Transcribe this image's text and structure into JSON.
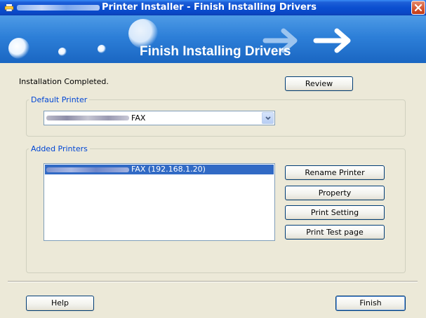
{
  "window": {
    "title": "Printer Installer - Finish Installing Drivers",
    "close_icon": "close-icon"
  },
  "banner": {
    "title": "Finish Installing Drivers"
  },
  "status": {
    "text": "Installation Completed."
  },
  "buttons": {
    "review": "Review",
    "rename_printer": "Rename Printer",
    "property": "Property",
    "print_setting": "Print Setting",
    "print_test_page": "Print Test page",
    "help": "Help",
    "finish": "Finish"
  },
  "default_printer": {
    "label": "Default Printer",
    "selected_value": "FAX"
  },
  "added_printers": {
    "label": "Added Printers",
    "items": [
      {
        "label": "FAX (192.168.1.20)",
        "selected": true
      }
    ]
  },
  "colors": {
    "titlebar": "#0b4fd0",
    "selection": "#316ac5",
    "group_label": "#0046d5",
    "window_bg": "#ece9d8"
  }
}
